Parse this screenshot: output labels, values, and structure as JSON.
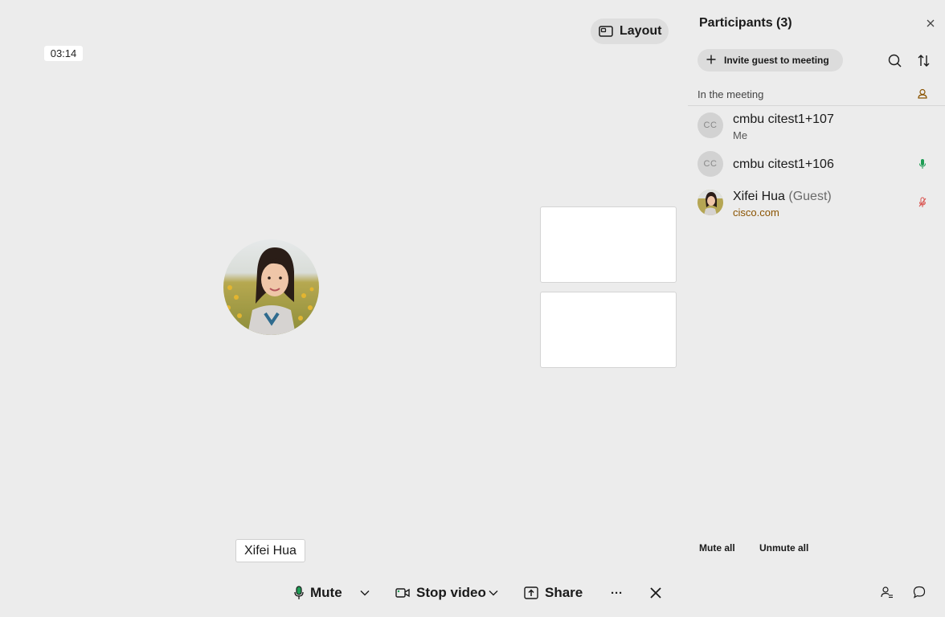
{
  "meeting": {
    "timer": "03:14",
    "layout_label": "Layout",
    "active_speaker_name": "Xifei Hua"
  },
  "toolbar": {
    "mute_label": "Mute",
    "stop_video_label": "Stop video",
    "share_label": "Share",
    "more_label": "···"
  },
  "participants_panel": {
    "title": "Participants (3)",
    "invite_label": "Invite guest to meeting",
    "section_label": "In the meeting",
    "participants": [
      {
        "initials": "CC",
        "name": "cmbu citest1+107",
        "sub": "Me",
        "mic": "none"
      },
      {
        "initials": "CC",
        "name": "cmbu citest1+106",
        "sub": "",
        "mic": "unmuted"
      },
      {
        "initials": "",
        "name": "Xifei Hua",
        "guest_tag": "(Guest)",
        "sub": "cisco.com",
        "mic": "muted"
      }
    ],
    "mute_all_label": "Mute all",
    "unmute_all_label": "Unmute all"
  },
  "colors": {
    "background": "#ececec",
    "mic_on": "#1f9d55",
    "mic_off": "#d9534f",
    "org_text": "#8a5300",
    "host_icon": "#8a5300"
  }
}
